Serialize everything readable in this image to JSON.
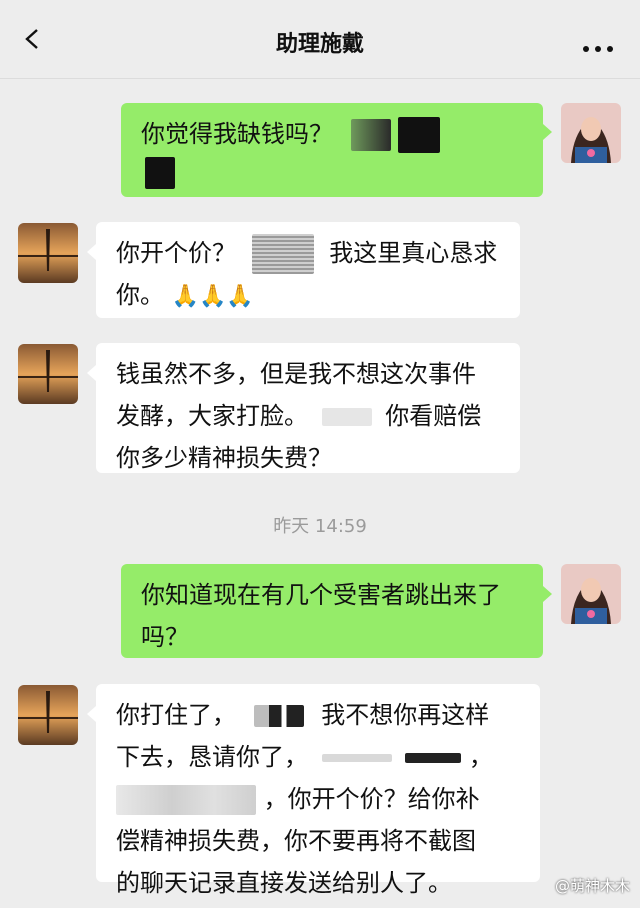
{
  "header": {
    "title": "助理施戴"
  },
  "timestamp": "昨天 14:59",
  "messages": {
    "m1": {
      "text1": "你觉得我缺钱吗？"
    },
    "m2": {
      "text1": "你开个价？",
      "text2": "我这里真心恳求",
      "text3": "你。"
    },
    "m3": {
      "text1": "钱虽然不多，但是我不想这次事件",
      "text2": "发酵，大家打脸。",
      "text3": "你看赔偿",
      "text4": "你多少精神损失费？"
    },
    "m4": {
      "text1": "你知道现在有几个受害者跳出来了",
      "text2": "吗？"
    },
    "m5": {
      "text1": "你打住了，",
      "text2": "我不想你再这样",
      "text3": "下去，恳请你了，",
      "text4": "，",
      "text5": "，你开个价？给你补",
      "text6": "偿精神损失费，你不要再将不截图",
      "text7": "的聊天记录直接发送给别人了。"
    }
  },
  "watermark": "@萌神木木",
  "icons": {
    "back": "chevron-left-icon",
    "more": "more-dots-icon",
    "pray": "folded-hands-icon"
  },
  "colors": {
    "outgoing_bubble": "#95ec69",
    "incoming_bubble": "#ffffff",
    "background": "#ededed"
  }
}
